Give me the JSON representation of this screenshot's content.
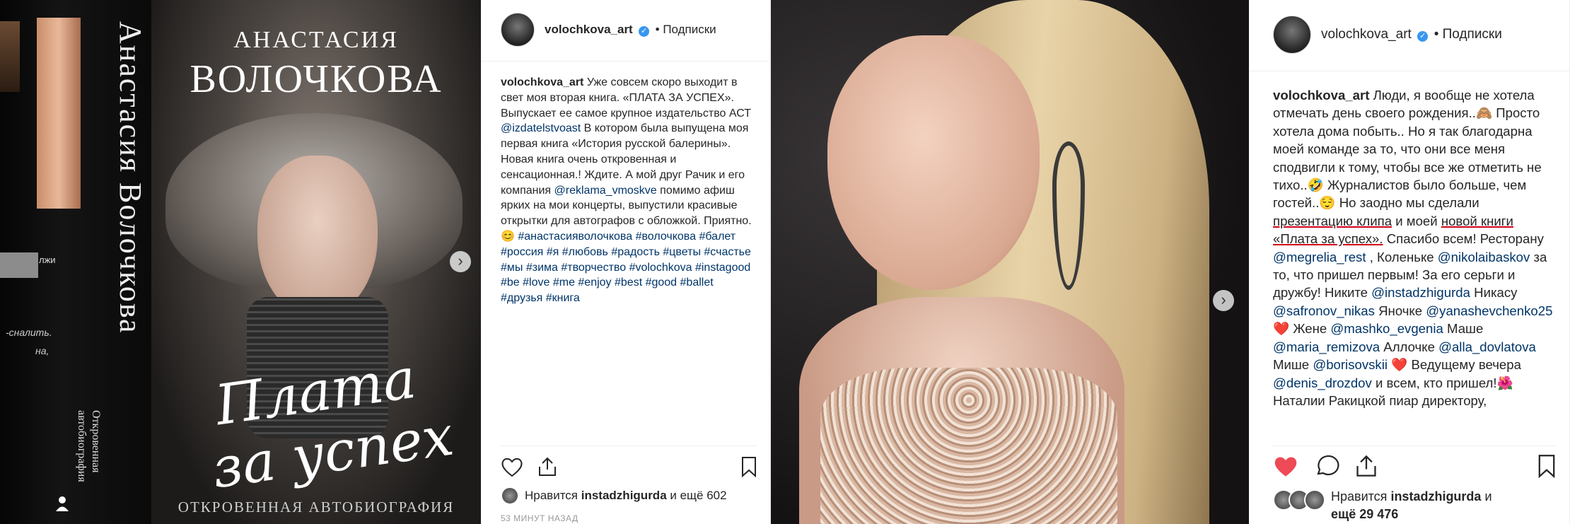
{
  "post1": {
    "image": {
      "side_text": "лжи",
      "side_note1": "-сналить.",
      "side_note2": "на,",
      "spine_title": "Анастасия Волочкова",
      "spine_subtitle": "Откровенная автобиография",
      "cover_name_first": "Анастасия",
      "cover_name_last": "Волочкова",
      "cover_title_line1": "Плата",
      "cover_title_line2": "за успех",
      "cover_subtitle": "ОТКРОВЕННАЯ АВТОБИОГРАФИЯ",
      "next_arrow": "›"
    },
    "header": {
      "username": "volochkova_art",
      "verified_glyph": "✓",
      "follow": "• Подписки"
    },
    "caption": {
      "username": "volochkova_art",
      "t1": " Уже совсем скоро выходит в свет моя вторая книга. «ПЛАТА ЗА УСПЕХ». Выпускает ее самое крупное издательство АСТ ",
      "m1": "@izdatelstvoast",
      "t2": " В котором была выпущена моя первая книга «История русской балерины». Новая книга очень откровенная и сенсационная.! Ждите. А мой друг Рачик и его компания ",
      "m2": "@reklama_vmoskve",
      "t3": " помимо афиш ярких на мои концерты, выпустили красивые открытки для автографов с обложкой. Приятно.😊 ",
      "tags": "#анастасияволочкова #волочкова #балет #россия #я #любовь #радость #цветы #счастье #мы #зима #творчество #volochkova #instagood #be #love #me #enjoy #best #good #ballet #друзья #книга"
    },
    "likes": {
      "prefix": "Нравится ",
      "user": "instadzhigurda",
      "suffix": " и ещё 602"
    },
    "time": "53 МИНУТ НАЗАД"
  },
  "post2": {
    "image": {
      "next_arrow": "›"
    },
    "header": {
      "username": "volochkova_art",
      "verified_glyph": "✓",
      "follow": "• Подписки"
    },
    "caption": {
      "username": "volochkova_art",
      "t1": " Люди, я вообще не хотела отмечать день своего рождения..🙈 Просто хотела дома побыть.. Но я так благодарна моей команде за то, что они все меня сподвигли к тому, чтобы все же отметить не тихо..🤣 Журналистов было больше, чем гостей..😌 Но заодно мы сделали ",
      "u1": "презентацию клипа",
      "t2": " и моей ",
      "u2": "новой книги «Плата за успех».",
      "t3": " Спасибо всем! Ресторану ",
      "m1": "@megrelia_rest",
      "t4": " , Коленьке ",
      "m2": "@nikolaibaskov",
      "t5": " за то, что пришел первым! За его серьги и дружбу! Никите ",
      "m3": "@instadzhigurda",
      "t6": " Никасу ",
      "m4": "@safronov_nikas",
      "t7": " Яночке ",
      "m5": "@yanashevchenko25",
      "t8": " ❤️ Жене ",
      "m6": "@mashko_evgenia",
      "t9": " Маше ",
      "m7": "@maria_remizova",
      "t10": " Аллочке ",
      "m8": "@alla_dovlatova",
      "t11": " Мише ",
      "m9": "@borisovskii",
      "t12": " ❤️ Ведущему вечера ",
      "m10": "@denis_drozdov",
      "t13": " и всем, кто пришел!🌺 Наталии Ракицкой пиар директору,"
    },
    "likes": {
      "prefix": "Нравится ",
      "user": "instadzhigurda",
      "suffix": " и",
      "line2": "ещё 29 476"
    }
  },
  "colors": {
    "like_red": "#ed4956",
    "mention": "#003569",
    "verified": "#3897f0",
    "underline_red": "#d0021b"
  }
}
